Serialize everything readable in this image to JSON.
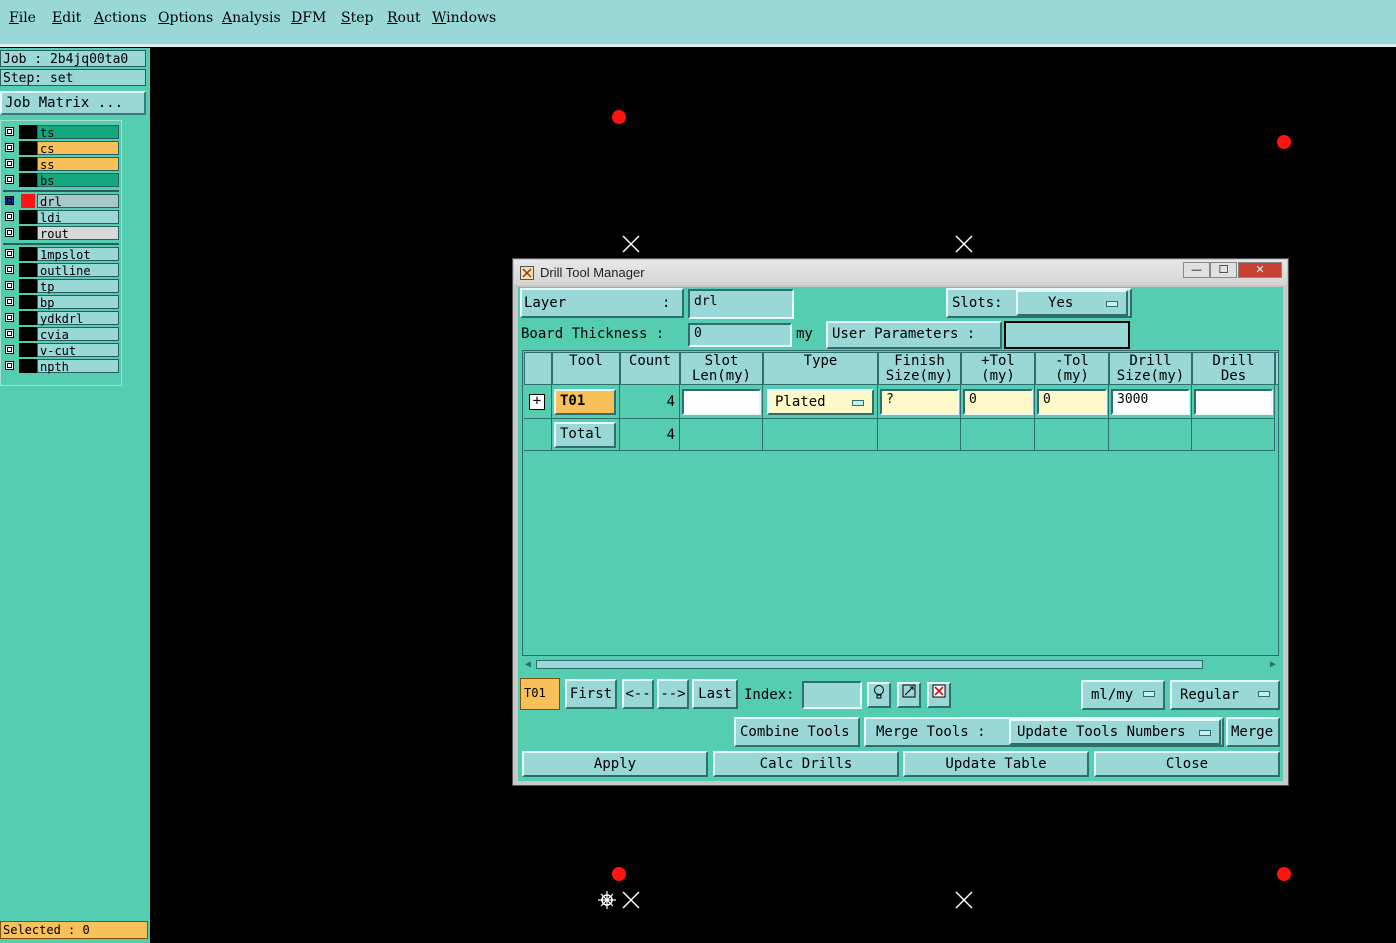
{
  "menu": [
    "File",
    "Edit",
    "Actions",
    "Options",
    "Analysis",
    "DFM",
    "Step",
    "Rout",
    "Windows"
  ],
  "sidebar": {
    "job": "Job : 2b4jq00ta0",
    "step": "Step: set",
    "job_matrix": "Job Matrix ...",
    "layers": [
      {
        "name": "ts",
        "color": "#14a87c"
      },
      {
        "name": "cs",
        "color": "#f8c058"
      },
      {
        "name": "ss",
        "color": "#f8c058"
      },
      {
        "name": "bs",
        "color": "#14a87c"
      },
      {
        "name": "drl",
        "color": "#a8c8c8"
      },
      {
        "name": "ldi",
        "color": "#9ad8d8"
      },
      {
        "name": "rout",
        "color": "#d8d8d8"
      },
      {
        "name": "1mpslot",
        "color": "#9ad8d8"
      },
      {
        "name": "outline",
        "color": "#9ad8d8"
      },
      {
        "name": "tp",
        "color": "#9ad8d8"
      },
      {
        "name": "bp",
        "color": "#9ad8d8"
      },
      {
        "name": "ydkdrl",
        "color": "#9ad8d8"
      },
      {
        "name": "cvia",
        "color": "#9ad8d8"
      },
      {
        "name": "v-cut",
        "color": "#9ad8d8"
      },
      {
        "name": "npth",
        "color": "#9ad8d8"
      }
    ],
    "selected": "Selected : 0"
  },
  "dialog": {
    "title": "Drill Tool Manager",
    "window_buttons": {
      "minimize": "—",
      "maximize": "☐",
      "close": "✕"
    },
    "layer_label": "Layer",
    "layer_colon": ":",
    "layer_value": "drl",
    "slots_label": "Slots:",
    "slots_value": "Yes",
    "board_thickness_label": "Board Thickness :",
    "board_thickness_value": "0",
    "board_thickness_unit": "my",
    "user_params_label": "User Parameters :",
    "user_params_value": "",
    "columns": [
      {
        "line1": "Tool",
        "line2": ""
      },
      {
        "line1": "Count",
        "line2": ""
      },
      {
        "line1": "Slot",
        "line2": "Len(my)"
      },
      {
        "line1": "Type",
        "line2": ""
      },
      {
        "line1": "Finish",
        "line2": "Size(my)"
      },
      {
        "line1": "+Tol",
        "line2": "(my)"
      },
      {
        "line1": "-Tol",
        "line2": "(my)"
      },
      {
        "line1": "Drill",
        "line2": "Size(my)"
      },
      {
        "line1": "Drill",
        "line2": "Des"
      }
    ],
    "rows": [
      {
        "tool": "T01",
        "count": "4",
        "slot_len": "",
        "type": "Plated",
        "finish": "?",
        "plus_tol": "0",
        "minus_tol": "0",
        "drill_size": "3000",
        "drill_des": ""
      }
    ],
    "total": {
      "label": "Total",
      "count": "4"
    },
    "nav": {
      "current_tool": "T01",
      "first": "First",
      "prev": "<--",
      "next": "-->",
      "last": "Last",
      "index_label": "Index:",
      "index_value": "",
      "units": "ml/my",
      "mode": "Regular"
    },
    "combine_tools": "Combine Tools",
    "merge_tools_label": "Merge Tools :",
    "merge_option": "Update Tools Numbers",
    "merge": "Merge",
    "apply": "Apply",
    "calc_drills": "Calc Drills",
    "update_table": "Update Table",
    "close": "Close"
  }
}
